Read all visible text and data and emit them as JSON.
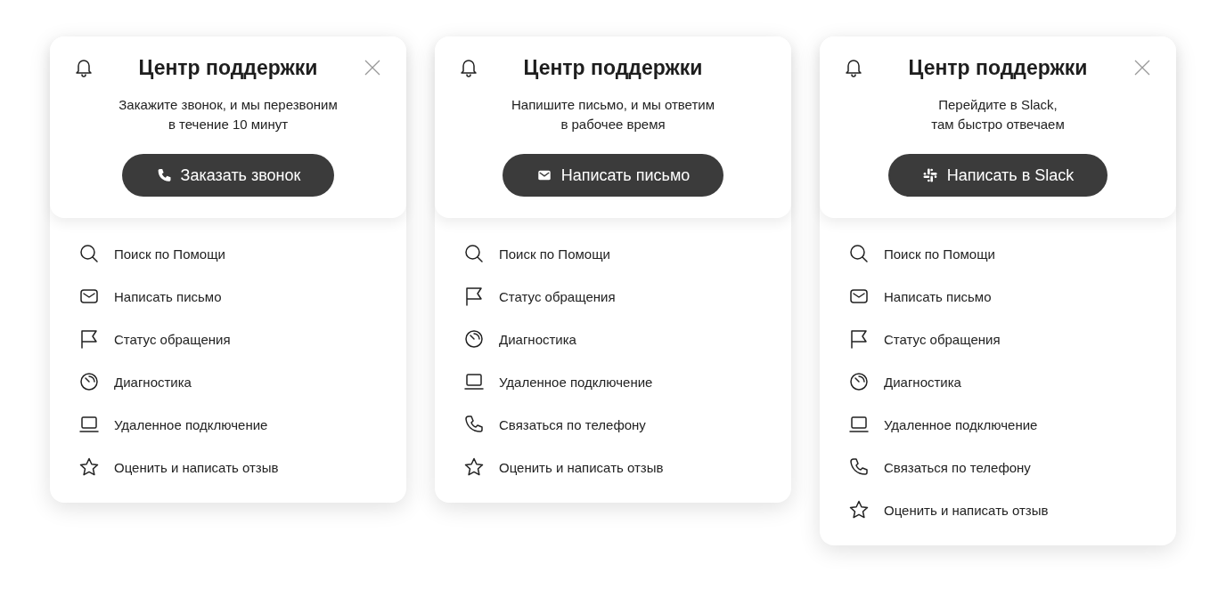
{
  "panels": [
    {
      "title": "Центр поддержки",
      "closable": true,
      "description": [
        "Закажите звонок, и мы перезвоним",
        "в течение 10 минут"
      ],
      "action": {
        "label": "Заказать звонок",
        "kind": "phone"
      },
      "items": [
        {
          "label": "Поиск по Помощи",
          "kind": "search"
        },
        {
          "label": "Написать письмо",
          "kind": "mail"
        },
        {
          "label": "Статус обращения",
          "kind": "flag"
        },
        {
          "label": "Диагностика",
          "kind": "gauge"
        },
        {
          "label": "Удаленное подключение",
          "kind": "laptop"
        },
        {
          "label": "Оценить и написать отзыв",
          "kind": "star"
        }
      ]
    },
    {
      "title": "Центр поддержки",
      "closable": false,
      "description": [
        "Напишите письмо, и мы ответим",
        "в рабочее время"
      ],
      "action": {
        "label": "Написать письмо",
        "kind": "mail"
      },
      "items": [
        {
          "label": "Поиск по Помощи",
          "kind": "search"
        },
        {
          "label": "Статус обращения",
          "kind": "flag"
        },
        {
          "label": "Диагностика",
          "kind": "gauge"
        },
        {
          "label": "Удаленное подключение",
          "kind": "laptop"
        },
        {
          "label": "Связаться по телефону",
          "kind": "phone"
        },
        {
          "label": "Оценить и написать отзыв",
          "kind": "star"
        }
      ]
    },
    {
      "title": "Центр поддержки",
      "closable": true,
      "description": [
        "Перейдите в Slack,",
        "там быстро отвечаем"
      ],
      "action": {
        "label": "Написать в Slack",
        "kind": "slack"
      },
      "items": [
        {
          "label": "Поиск по Помощи",
          "kind": "search"
        },
        {
          "label": "Написать письмо",
          "kind": "mail"
        },
        {
          "label": "Статус обращения",
          "kind": "flag"
        },
        {
          "label": "Диагностика",
          "kind": "gauge"
        },
        {
          "label": "Удаленное подключение",
          "kind": "laptop"
        },
        {
          "label": "Связаться по телефону",
          "kind": "phone"
        },
        {
          "label": "Оценить и написать отзыв",
          "kind": "star"
        }
      ]
    }
  ]
}
